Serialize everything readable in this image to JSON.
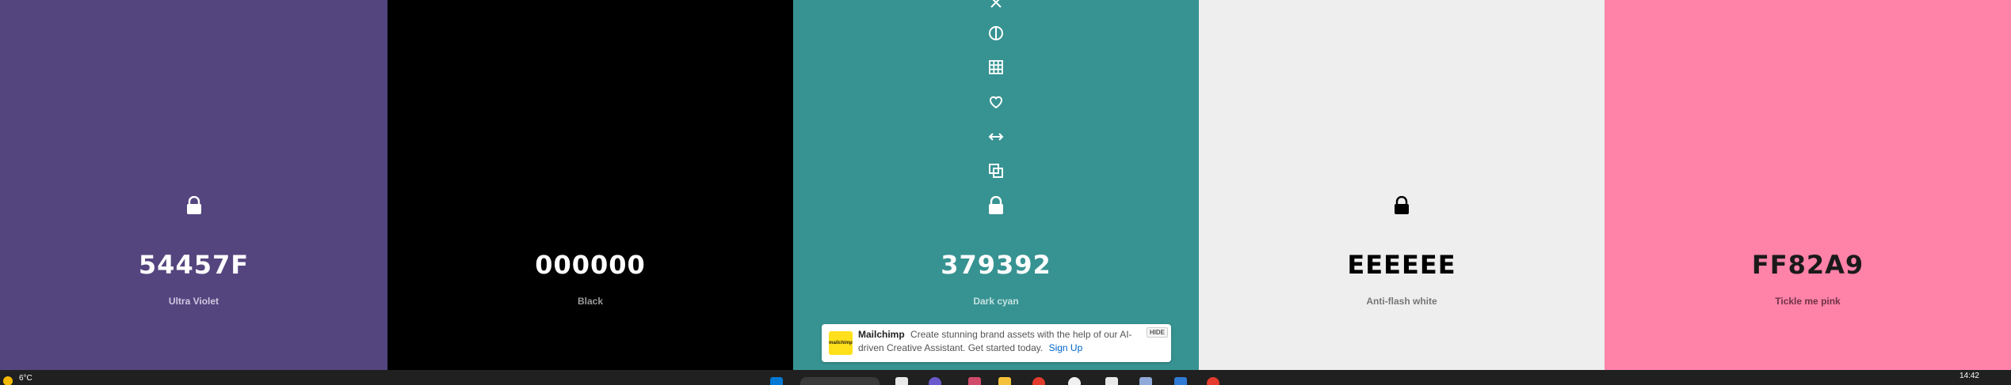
{
  "palette": [
    {
      "hex": "54457F",
      "name": "Ultra Violet",
      "bg": "#54457F",
      "fg": "#ffffff",
      "name_color": "#cfc8e0",
      "locked_icon": "lock-icon"
    },
    {
      "hex": "000000",
      "name": "Black",
      "bg": "#000000",
      "fg": "#ffffff",
      "name_color": "#9a9a9a",
      "locked_icon": "lock-icon"
    },
    {
      "hex": "379392",
      "name": "Dark cyan",
      "bg": "#379392",
      "fg": "#ffffff",
      "name_color": "#c4e2e1",
      "locked_icon": "lock-icon"
    },
    {
      "hex": "EEEEEE",
      "name": "Anti-flash white",
      "bg": "#EEEEEE",
      "fg": "#000000",
      "name_color": "#777777",
      "locked_icon": "lock-icon"
    },
    {
      "hex": "FF82A9",
      "name": "Tickle me pink",
      "bg": "#FF82A9",
      "fg": "#1a1a1a",
      "name_color": "#6e3346",
      "locked_icon": null
    }
  ],
  "column_tools": [
    "close-icon",
    "contrast-icon",
    "shades-grid-icon",
    "heart-icon",
    "drag-arrows-icon",
    "copy-icon",
    "lock-icon"
  ],
  "ad": {
    "logo_text": "mailchimp",
    "brand": "Mailchimp",
    "text": "Create stunning brand assets with the help of our AI-driven Creative Assistant. Get started today.",
    "link": "Sign Up",
    "hide": "HIDE"
  },
  "taskbar": {
    "temperature": "6°C",
    "time": "14:42",
    "accent": "#0078d4"
  }
}
